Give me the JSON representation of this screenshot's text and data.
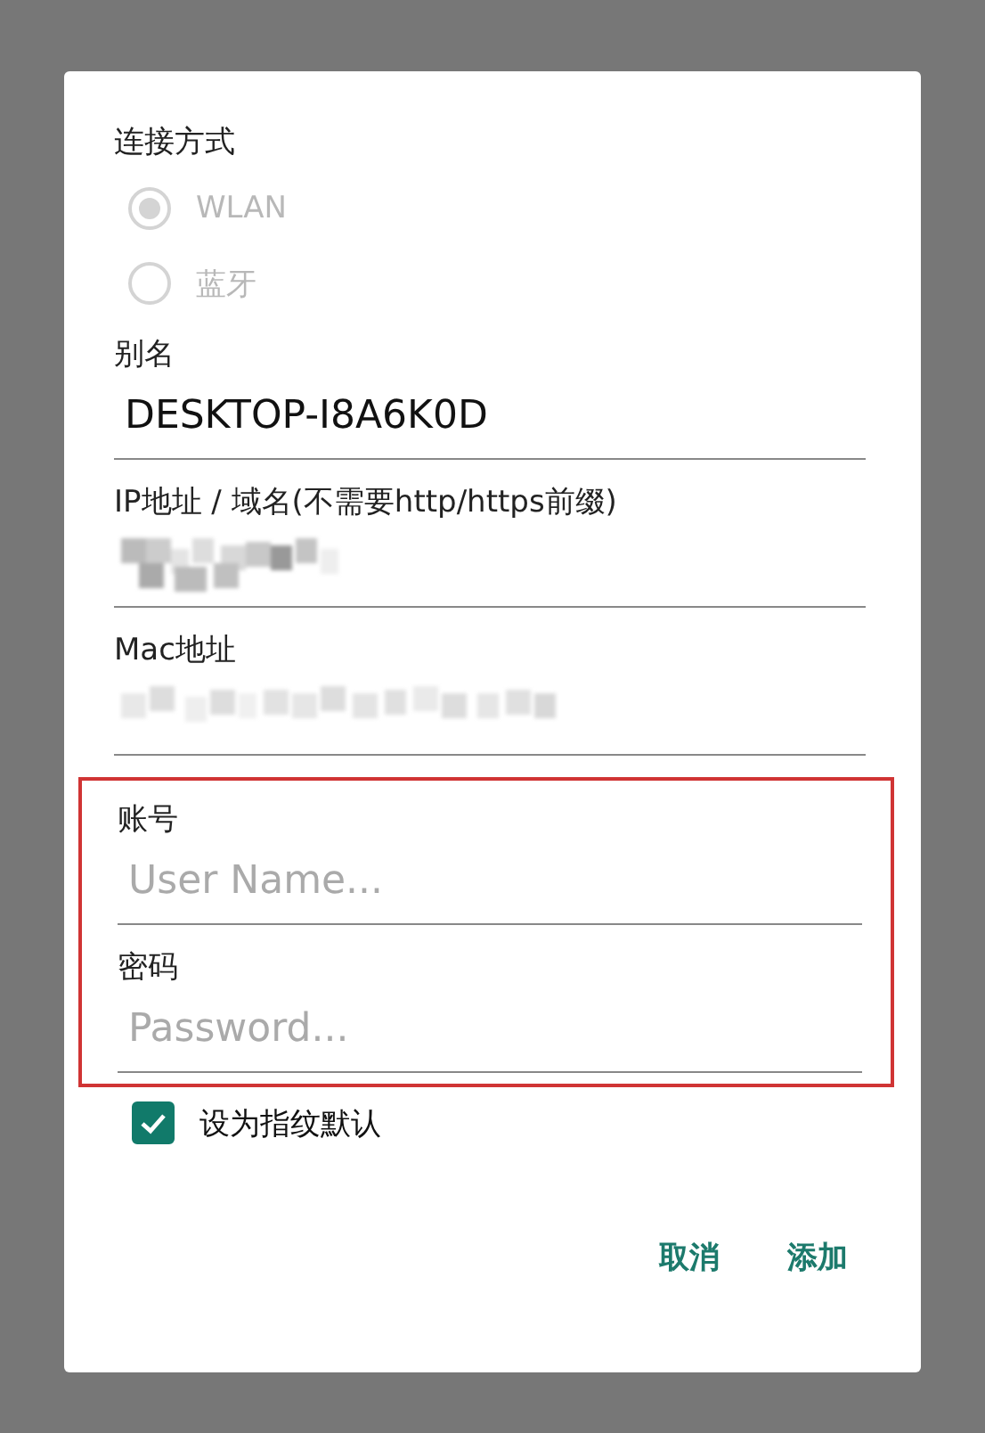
{
  "connection": {
    "label": "连接方式",
    "disabled": true,
    "options": [
      {
        "label": "WLAN",
        "selected": true
      },
      {
        "label": "蓝牙",
        "selected": false
      }
    ]
  },
  "fields": [
    {
      "kind": "text",
      "label": "别名",
      "value": "DESKTOP-I8A6K0D"
    },
    {
      "kind": "redacted",
      "label": "IP地址 / 域名(不需要http/https前缀)"
    },
    {
      "kind": "redacted",
      "label": "Mac地址"
    }
  ],
  "credentials": {
    "highlighted": true,
    "fields": [
      {
        "label": "账号",
        "placeholder": "User Name..."
      },
      {
        "label": "密码",
        "placeholder": "Password..."
      }
    ]
  },
  "fingerprint_default": {
    "label": "设为指纹默认",
    "checked": true
  },
  "buttons": [
    "取消",
    "添加"
  ]
}
